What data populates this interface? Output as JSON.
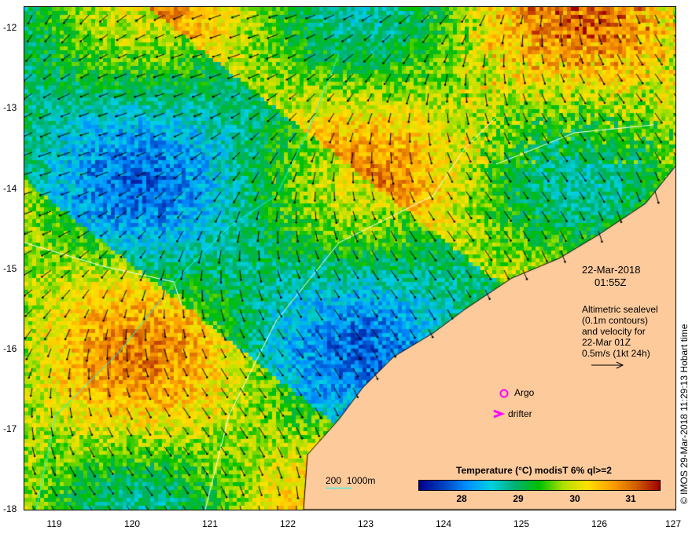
{
  "map": {
    "lon_range": [
      118.6,
      127
    ],
    "lat_range": [
      -18,
      -11.74
    ],
    "lat_ticks": [
      "-12",
      "-13",
      "-14",
      "-15",
      "-16",
      "-17",
      "-18"
    ],
    "lon_ticks": [
      "119",
      "120",
      "121",
      "122",
      "123",
      "124",
      "125",
      "126",
      "127"
    ]
  },
  "annotations": {
    "date": "22-Mar-2018",
    "time": "01:55Z",
    "desc": [
      "Altimetric sealevel",
      "(0.1m contours)",
      "and velocity for",
      "22-Mar 01Z",
      "0.5m/s (1kt 24h)"
    ],
    "argo_label": "Argo",
    "drifter_label": "drifter",
    "depth_legend": "200  1000m"
  },
  "colorbar": {
    "title": "Temperature (°C) modisT 6% ql>=2",
    "ticks": [
      "28",
      "29",
      "30",
      "31"
    ],
    "range": [
      27.25,
      31.6
    ]
  },
  "credit": "© IMOS 29-Mar-2018 11:29:13 Hobart time",
  "colors": {
    "land": "#fdca9c",
    "argo": "#ff00ff",
    "depth200": "#00ffff"
  }
}
